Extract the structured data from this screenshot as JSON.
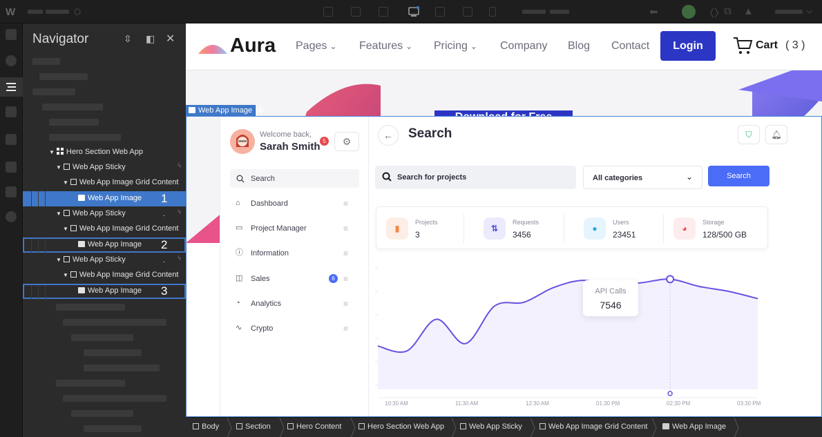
{
  "app": {
    "logo": "W"
  },
  "navigator": {
    "title": "Navigator",
    "rows": [
      {
        "label": "Hero Section Web App",
        "kind": "grid"
      },
      {
        "label": "Web App Sticky",
        "kind": "box"
      },
      {
        "label": "Web App Image Grid Content",
        "kind": "box"
      },
      {
        "label": "Web App Image",
        "kind": "image",
        "marker": "1"
      },
      {
        "label": "Web App Sticky",
        "kind": "box"
      },
      {
        "label": "Web App Image Grid Content",
        "kind": "box"
      },
      {
        "label": "Web App Image",
        "kind": "image",
        "marker": "2"
      },
      {
        "label": "Web App Sticky",
        "kind": "box"
      },
      {
        "label": "Web App Image Grid Content",
        "kind": "box"
      },
      {
        "label": "Web App Image",
        "kind": "image",
        "marker": "3"
      }
    ]
  },
  "site": {
    "brand": "Aura",
    "menu": [
      {
        "label": "Pages",
        "has_dropdown": true
      },
      {
        "label": "Features",
        "has_dropdown": true
      },
      {
        "label": "Pricing",
        "has_dropdown": true
      },
      {
        "label": "Company",
        "has_dropdown": false
      },
      {
        "label": "Blog",
        "has_dropdown": false
      },
      {
        "label": "Contact",
        "has_dropdown": false
      }
    ],
    "login_label": "Login",
    "cart_label": "Cart",
    "cart_count": "( 3 )",
    "hero_button": "Download for Free",
    "accent_color": "#2c36c4"
  },
  "selection": {
    "label": "Web App Image"
  },
  "webapp": {
    "welcome": "Welcome back,",
    "user_name": "Sarah Smith",
    "notification_count": "5",
    "sidebar_search": "Search",
    "sidebar_items": [
      {
        "label": "Dashboard",
        "icon": "home-icon"
      },
      {
        "label": "Project Manager",
        "icon": "folder-icon"
      },
      {
        "label": "Information",
        "icon": "info-icon"
      },
      {
        "label": "Sales",
        "icon": "bag-icon",
        "badge": "6"
      },
      {
        "label": "Analytics",
        "icon": "pie-icon"
      },
      {
        "label": "Crypto",
        "icon": "pulse-icon"
      }
    ],
    "page_title": "Search",
    "search_placeholder": "Search for projects",
    "category_selected": "All categories",
    "search_button": "Search",
    "stats": [
      {
        "label": "Projects",
        "value": "3",
        "chip_color": "#fdeee5",
        "icon_color": "#f08a4b"
      },
      {
        "label": "Requests",
        "value": "3456",
        "chip_color": "#ecebfd",
        "icon_color": "#5a4de0"
      },
      {
        "label": "Users",
        "value": "23451",
        "chip_color": "#e6f4fd",
        "icon_color": "#2aa8e0"
      },
      {
        "label": "Storage",
        "value": "128/500 GB",
        "chip_color": "#fdecee",
        "icon_color": "#e5484d"
      }
    ],
    "tooltip": {
      "label": "API Calls",
      "value": "7546"
    }
  },
  "chart_data": {
    "type": "line",
    "x": [
      "10:30 AM",
      "11:30 AM",
      "12:30 AM",
      "01:30 PM",
      "02:30 PM",
      "03:30 PM"
    ],
    "series": [
      {
        "values": [
          3,
          2.6,
          5.2,
          3.2,
          6.3,
          6.6,
          7.8,
          8.4,
          8.0,
          8.2,
          8.5,
          7.9,
          7.5,
          6.9
        ]
      }
    ],
    "highlight_index": 10,
    "line_color": "#6a4fe0"
  },
  "breadcrumbs": [
    {
      "label": "Body",
      "kind": "box"
    },
    {
      "label": "Section",
      "kind": "box"
    },
    {
      "label": "Hero Content",
      "kind": "box"
    },
    {
      "label": "Hero Section Web App",
      "kind": "box"
    },
    {
      "label": "Web App Sticky",
      "kind": "box"
    },
    {
      "label": "Web App Image Grid Content",
      "kind": "box"
    },
    {
      "label": "Web App Image",
      "kind": "image"
    }
  ]
}
